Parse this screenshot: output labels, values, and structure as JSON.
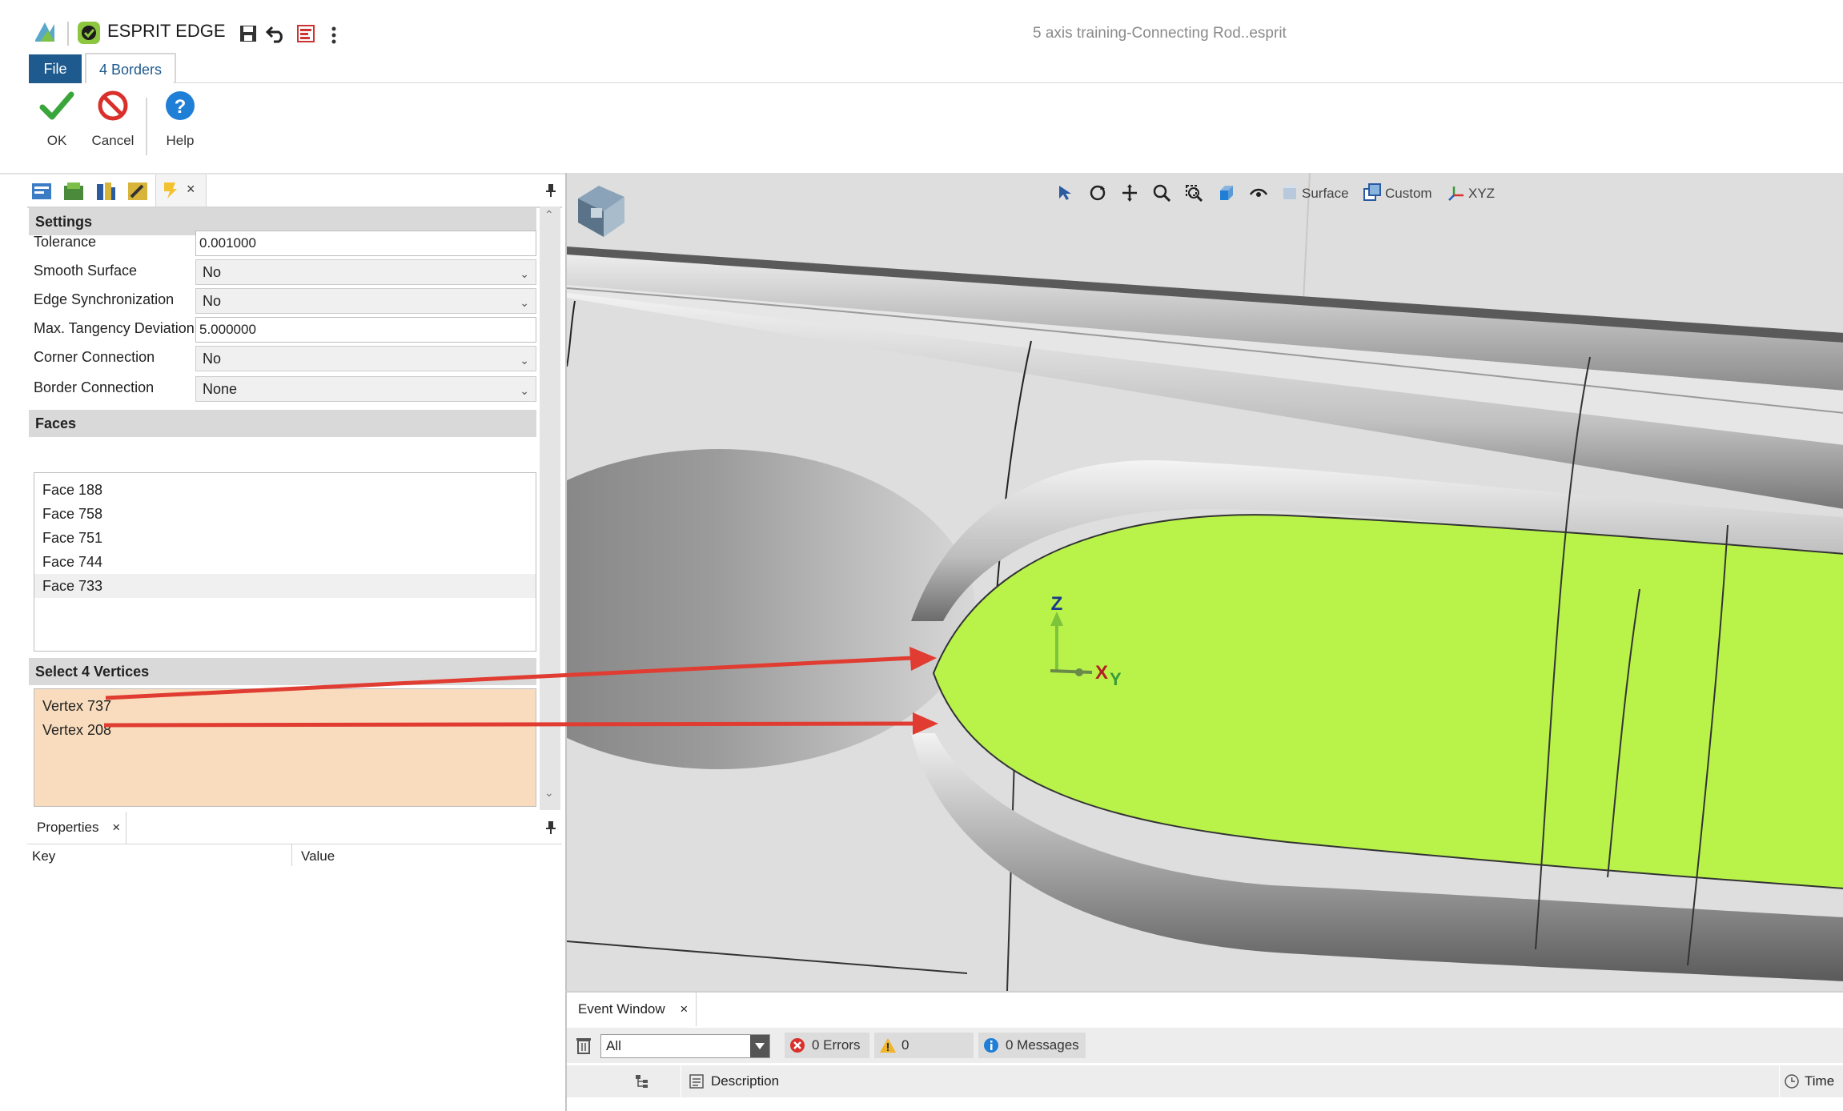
{
  "titlebar": {
    "app_name": "ESPRIT EDGE",
    "document_title": "5 axis training-Connecting Rod..esprit"
  },
  "ribbon": {
    "tabs": [
      {
        "label": "File"
      },
      {
        "label": "4 Borders"
      }
    ],
    "buttons": [
      {
        "label": "OK",
        "icon": "check-icon"
      },
      {
        "label": "Cancel",
        "icon": "cancel-icon"
      },
      {
        "label": "Help",
        "icon": "help-icon"
      }
    ]
  },
  "panel": {
    "settings": {
      "header": "Settings",
      "rows": [
        {
          "label": "Tolerance",
          "value": "0.001000",
          "type": "text"
        },
        {
          "label": "Smooth Surface",
          "value": "No",
          "type": "select"
        },
        {
          "label": "Edge Synchronization",
          "value": "No",
          "type": "select"
        },
        {
          "label": "Max. Tangency Deviation",
          "value": "5.000000",
          "type": "text"
        },
        {
          "label": "Corner Connection",
          "value": "No",
          "type": "select"
        },
        {
          "label": "Border Connection",
          "value": "None",
          "type": "select"
        }
      ]
    },
    "faces": {
      "header": "Faces",
      "items": [
        "Face 188",
        "Face 758",
        "Face 751",
        "Face 744",
        "Face 733"
      ],
      "selected_index": 4
    },
    "vertices": {
      "header": "Select 4 Vertices",
      "items": [
        "Vertex 737",
        "Vertex 208"
      ],
      "highlight_color": "#f8dcbd"
    },
    "close_glyph": "×"
  },
  "properties": {
    "tab_label": "Properties",
    "columns": [
      "Key",
      "Value"
    ]
  },
  "viewport": {
    "toolbar": {
      "surface_label": "Surface",
      "custom_label": "Custom",
      "xyz_label": "XYZ"
    },
    "axes": {
      "z": "Z",
      "x": "X",
      "y": "Y"
    },
    "highlight_face_color": "#b9f34a",
    "arrow_color": "#e03c31"
  },
  "event_window": {
    "tab_label": "Event Window",
    "filter_value": "All",
    "errors": "0 Errors",
    "warnings": "0 Warnings",
    "messages": "0 Messages",
    "columns": [
      "Description",
      "Time"
    ]
  },
  "colors": {
    "accent": "#1e5a8e",
    "ok_green": "#3aa53a",
    "cancel_red": "#d9302c",
    "help_blue": "#1f7fd6"
  }
}
